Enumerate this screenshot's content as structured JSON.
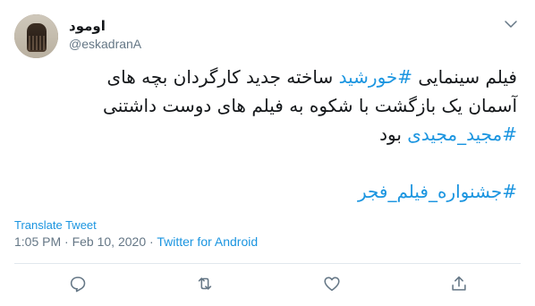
{
  "user": {
    "display_name": "اومود",
    "handle": "@eskadranA"
  },
  "tweet": {
    "line1_pre": "فیلم سینمایی ",
    "line1_hashtag": "#خورشید",
    "line1_post": " ساخته جدید کارگردان بچه های",
    "line2": "آسمان یک بازگشت با شکوه به فیلم های دوست داشتنی",
    "line3_hashtag": "#مجید_مجیدی",
    "line3_post": " بود",
    "line4_hashtag": "#جشنواره_فیلم_فجر"
  },
  "translate_label": "Translate Tweet",
  "meta": {
    "time": "1:05 PM",
    "separator1": " · ",
    "date": "Feb 10, 2020",
    "separator2": " · ",
    "source": "Twitter for Android"
  },
  "icons": {
    "menu": "chevron-down-icon",
    "reply": "reply-icon",
    "retweet": "retweet-icon",
    "like": "heart-icon",
    "share": "share-icon"
  },
  "colors": {
    "link": "#1b95e0",
    "secondary_text": "#657786",
    "primary_text": "#14171a",
    "divider": "#e1e8ed"
  }
}
